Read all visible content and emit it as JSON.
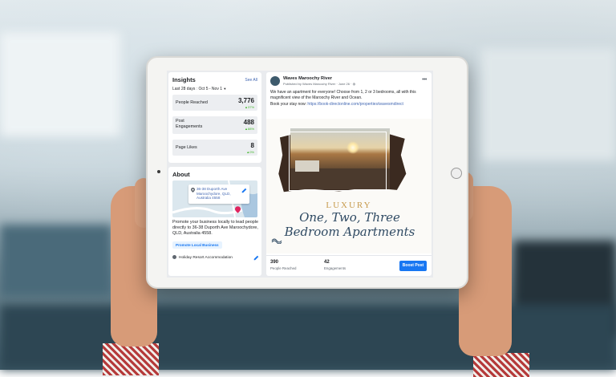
{
  "insights": {
    "title": "Insights",
    "see_all": "See All",
    "range_label": "Last 28 days",
    "range_value": "Oct 5 - Nov 1",
    "metrics": [
      {
        "label": "People Reached",
        "value": "3,776",
        "change": "▲37%"
      },
      {
        "label": "Post\nEngagements",
        "value": "488",
        "change": "▲88%"
      },
      {
        "label": "Page Likes",
        "value": "8",
        "change": "▲0%"
      }
    ]
  },
  "about": {
    "title": "About",
    "address": "36-38 Duporth Ave Maroochydore, QLD, Australia 4558",
    "description": "Promote your business locally to lead people directly to 36-38 Duporth Ave Maroochydore, QLD, Australia 4558.",
    "promote_button": "Promote Local Business",
    "category": "Holiday Resort Accommodation"
  },
  "post": {
    "page_name": "Waves Maroochy River",
    "meta": "Published by Waves Maroochy River · June 26 · ",
    "text": "We have an apartment for everyone! Choose from 1, 2 or 3 bedrooms, all with this magnificent view of the Maroochy River and Ocean.",
    "cta_text": "Book your stay now: ",
    "link": "https://book-directonline.com/properties/wavesmdirect",
    "image_heading": "LUXURY",
    "image_script_1": "One, Two, Three",
    "image_script_2": "Bedroom Apartments",
    "people_reached": "390",
    "people_reached_label": "People Reached",
    "engagements": "42",
    "engagements_label": "Engagements",
    "boost_button": "Boost Post"
  },
  "colors": {
    "accent": "#1877f2",
    "link": "#4267b2",
    "positive": "#42b72a",
    "luxury_gold": "#c79b4d",
    "script_navy": "#2f4a63"
  }
}
